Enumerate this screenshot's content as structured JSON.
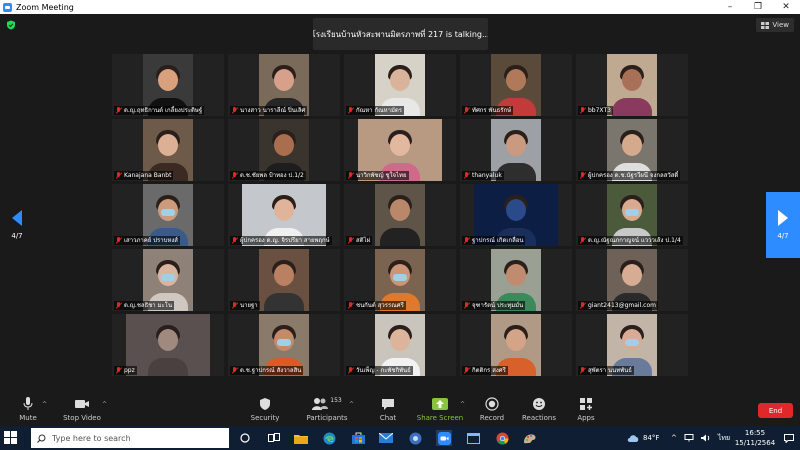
{
  "window": {
    "title": "Zoom Meeting",
    "minimize": "–",
    "restore": "❐",
    "close": "✕"
  },
  "meeting": {
    "talking": "โรงเรียนบ้านหัวสะพานมิตรภาพที่ 217 is talking...",
    "view_label": "View",
    "page_left": "4/7",
    "page_right": "4/7"
  },
  "participants": [
    {
      "name": "ด.ญ.ฤทธิกานต์ เกลี้ยงประดิษฐ์",
      "muted": true,
      "skin": "#d9a07e",
      "shirt": "#111111",
      "bg": "#3a3a3a",
      "wide": false,
      "mask": false
    },
    {
      "name": "นางสาว นาราลีณ์ ปิ่นเลิศ",
      "muted": true,
      "skin": "#d6a08a",
      "shirt": "#262626",
      "bg": "#7a6a5a",
      "wide": false,
      "mask": false
    },
    {
      "name": "กัณหา กัณหามัดร",
      "muted": true,
      "skin": "#d9b49a",
      "shirt": "#e8e8e8",
      "bg": "#d7d2c8",
      "wide": false,
      "mask": false
    },
    {
      "name": "ทัศกร พันธรักษ์",
      "muted": true,
      "skin": "#b07a5a",
      "shirt": "#c23a3a",
      "bg": "#5a4a3a",
      "wide": false,
      "mask": false
    },
    {
      "name": "bb7XT3",
      "muted": true,
      "skin": "#a97058",
      "shirt": "#8a3a5e",
      "bg": "#bfa990",
      "wide": false,
      "mask": false
    },
    {
      "name": "Kanajana Banbt",
      "muted": true,
      "skin": "#dcb096",
      "shirt": "#3a2a22",
      "bg": "#6e5a48",
      "wide": false,
      "mask": false
    },
    {
      "name": "ด.ช.ชัยพล ป้าทอง ป.1/2",
      "muted": true,
      "skin": "#a86e4e",
      "shirt": "#1e1e1e",
      "bg": "#3a342e",
      "wide": false,
      "mask": false
    },
    {
      "name": "นาวิกพัชญ์ ชูใจไทย",
      "muted": true,
      "skin": "#e2b89e",
      "shirt": "#d06a8a",
      "bg": "#b89a82",
      "wide": true,
      "mask": false
    },
    {
      "name": "thanyaluk",
      "muted": true,
      "skin": "#c99a80",
      "shirt": "#2e2e2e",
      "bg": "#9da1a6",
      "wide": false,
      "mask": false
    },
    {
      "name": "ผู้ปกครอง ด.ช.นัฐรวีผนึ จงกลสวัสดิ์",
      "muted": true,
      "skin": "#d4a98c",
      "shirt": "#dedede",
      "bg": "#7a766e",
      "wide": false,
      "mask": false
    },
    {
      "name": "เสาวภาคย์ ปราบหงส์",
      "muted": true,
      "skin": "#cc9a7c",
      "shirt": "#3a5a8a",
      "bg": "#6a6a6a",
      "wide": false,
      "mask": true
    },
    {
      "name": "ผู้ปกครอง ด.ญ. จิรปรียา สายพฤกษ์",
      "muted": true,
      "skin": "#e0b49a",
      "shirt": "#f0f0f0",
      "bg": "#c4c8cc",
      "wide": true,
      "mask": false
    },
    {
      "name": "สติไผ่",
      "muted": true,
      "skin": "#b9876a",
      "shirt": "#222222",
      "bg": "#5e5448",
      "wide": false,
      "mask": false
    },
    {
      "name": "ฐาปกรณ์ เกิดเกลื่อน",
      "muted": true,
      "skin": "#2a4a8a",
      "shirt": "#1a2e5a",
      "bg": "#0c1e44",
      "wide": true,
      "mask": false
    },
    {
      "name": "ด.ญ.ณัฐณภกาญจน์ แวววเส้ง ป.1/4",
      "muted": true,
      "skin": "#d8aa8e",
      "shirt": "#c8c8c8",
      "bg": "#4a5a3a",
      "wide": false,
      "mask": true
    },
    {
      "name": "ด.ญ.ชลธิชา มะโน",
      "muted": true,
      "skin": "#d9b5a0",
      "shirt": "#d0c8c0",
      "bg": "#8e8278",
      "wide": false,
      "mask": true
    },
    {
      "name": "นายฐา",
      "muted": true,
      "skin": "#b98062",
      "shirt": "#333333",
      "bg": "#6a5040",
      "wide": false,
      "mask": false
    },
    {
      "name": "ชนกันต์ สุวรรณศรี",
      "muted": true,
      "skin": "#cb9576",
      "shirt": "#e07a2a",
      "bg": "#7a6450",
      "wide": false,
      "mask": true
    },
    {
      "name": "จุฑารัตน์ ประทุมมั่น",
      "muted": true,
      "skin": "#c08c70",
      "shirt": "#3a8a5a",
      "bg": "#9aa094",
      "wide": false,
      "mask": false
    },
    {
      "name": "giant2413@gmail.com",
      "muted": true,
      "skin": "#d6ac92",
      "shirt": "#2a2a2a",
      "bg": "#6e6258",
      "wide": false,
      "mask": false
    },
    {
      "name": "ppz",
      "muted": true,
      "skin": "#a08a80",
      "shirt": "#4a4040",
      "bg": "#5a5050",
      "wide": true,
      "mask": false
    },
    {
      "name": "ด.ช.ฐาปกรณ์ สังวาลสิน",
      "muted": true,
      "skin": "#c58a6a",
      "shirt": "#e0582a",
      "bg": "#8a7a6a",
      "wide": false,
      "mask": true
    },
    {
      "name": "วันเพ็ญ - กะพัชกิพันธ์",
      "muted": true,
      "skin": "#dcb49c",
      "shirt": "#f2f2f2",
      "bg": "#c9c4bc",
      "wide": false,
      "mask": false
    },
    {
      "name": "กิตติกร สงศรี",
      "muted": true,
      "skin": "#d4a488",
      "shirt": "#d8602a",
      "bg": "#b09a86",
      "wide": false,
      "mask": false
    },
    {
      "name": "สุพัตรา นนทพันธ์",
      "muted": true,
      "skin": "#d8ac94",
      "shirt": "#6a7a9a",
      "bg": "#c2b4a6",
      "wide": false,
      "mask": true
    }
  ],
  "toolbar": {
    "mute": "Mute",
    "stop_video": "Stop Video",
    "security": "Security",
    "participants": "Participants",
    "participants_count": "153",
    "chat": "Chat",
    "share_screen": "Share Screen",
    "record": "Record",
    "reactions": "Reactions",
    "apps": "Apps",
    "end": "End",
    "caret": "^"
  },
  "taskbar": {
    "search_placeholder": "Type here to search",
    "weather": "84°F",
    "language": "ไทย",
    "time": "16:55",
    "date": "15/11/2564"
  },
  "colors": {
    "accent": "#2d8cff",
    "end": "#e02828",
    "talking_border": "#8ac43f"
  }
}
